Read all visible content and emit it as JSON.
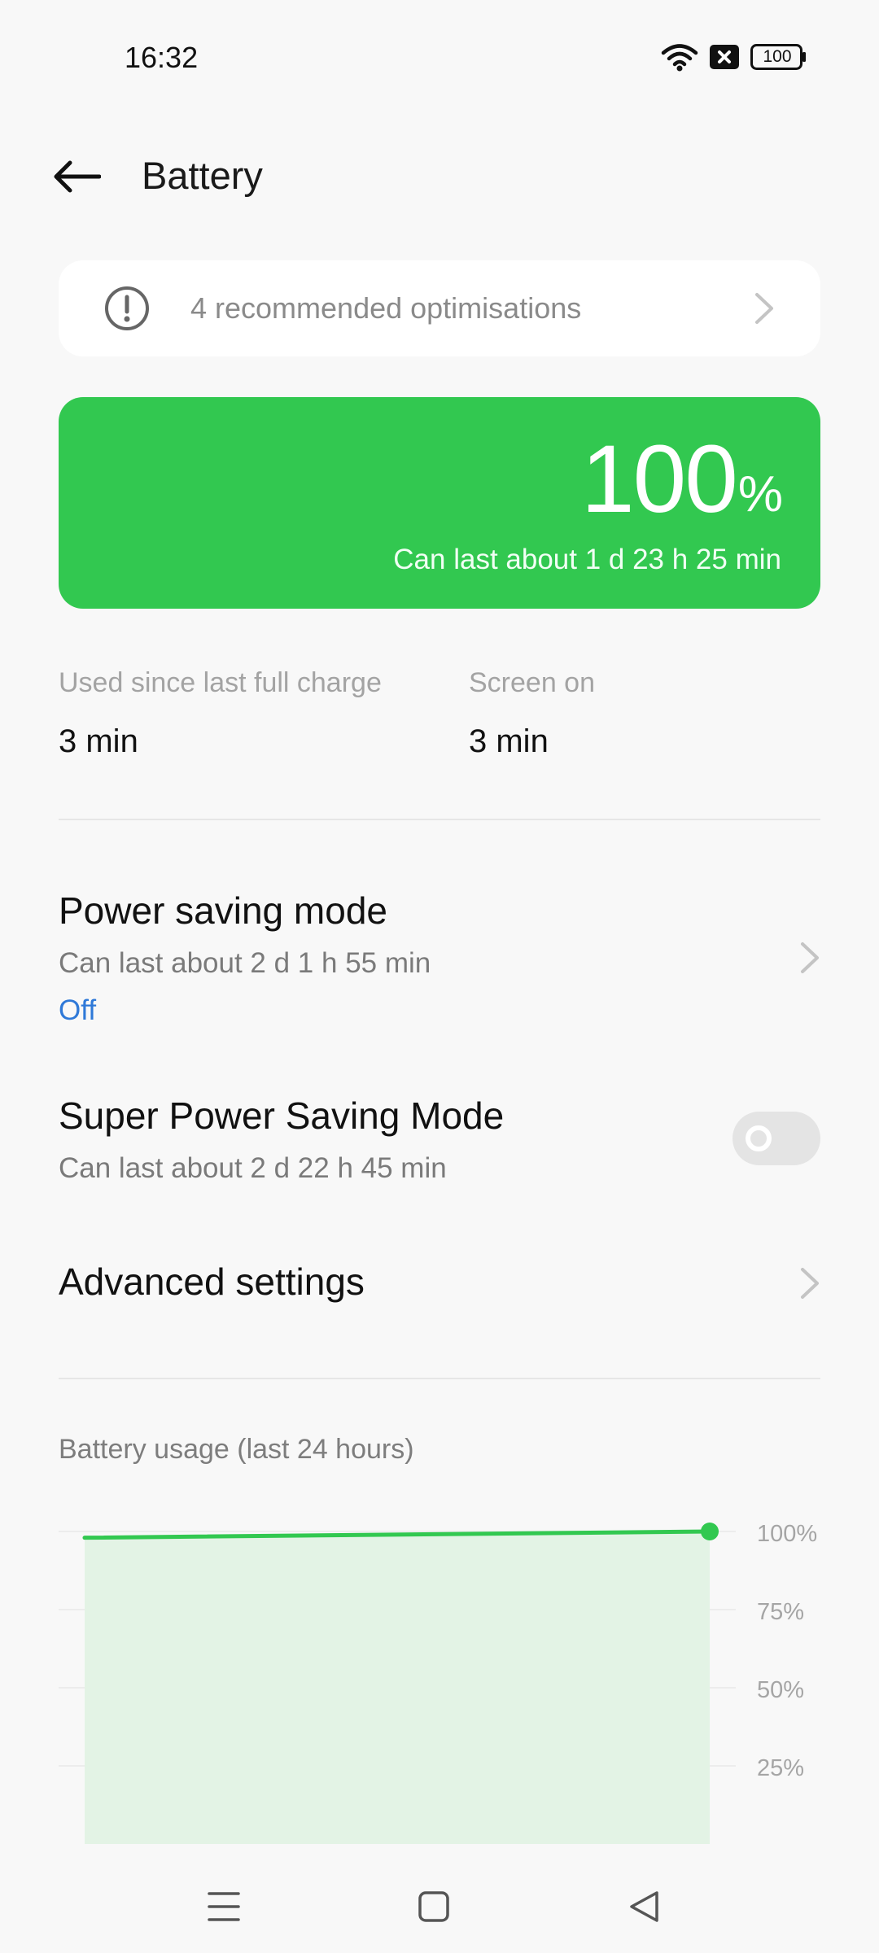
{
  "status_bar": {
    "time": "16:32",
    "battery_level": "100",
    "icons": [
      "wifi-icon",
      "no-sim-icon",
      "battery-icon"
    ]
  },
  "header": {
    "title": "Battery",
    "back_icon": "arrow-left-icon"
  },
  "recommendations": {
    "label": "4 recommended optimisations",
    "icon": "alert-circle-icon"
  },
  "battery": {
    "percent": "100",
    "unit": "%",
    "estimate": "Can last about 1 d 23 h 25 min",
    "accent_color": "#32c850"
  },
  "usage": {
    "since_charge_label": "Used since last full charge",
    "since_charge_value": "3 min",
    "screen_on_label": "Screen on",
    "screen_on_value": "3 min"
  },
  "settings": {
    "power_saving": {
      "title": "Power saving mode",
      "subtitle": "Can last about 2 d 1 h 55 min",
      "status": "Off"
    },
    "super_power_saving": {
      "title": "Super Power Saving Mode",
      "subtitle": "Can last about 2 d 22 h 45 min",
      "enabled": false
    },
    "advanced": {
      "title": "Advanced settings"
    }
  },
  "chart_title": "Battery usage (last 24 hours)",
  "chart_data": {
    "type": "area",
    "title": "Battery usage (last 24 hours)",
    "x": [
      0,
      1
    ],
    "values": [
      98,
      100
    ],
    "ylim": [
      0,
      100
    ],
    "y_ticks": [
      "100%",
      "75%",
      "50%",
      "25%"
    ],
    "y_tick_values": [
      100,
      75,
      50,
      25
    ],
    "grid": true,
    "color": "#32c850"
  },
  "nav": {
    "menu_icon": "menu-icon",
    "home_icon": "home-icon",
    "back_icon": "back-triangle-icon"
  }
}
